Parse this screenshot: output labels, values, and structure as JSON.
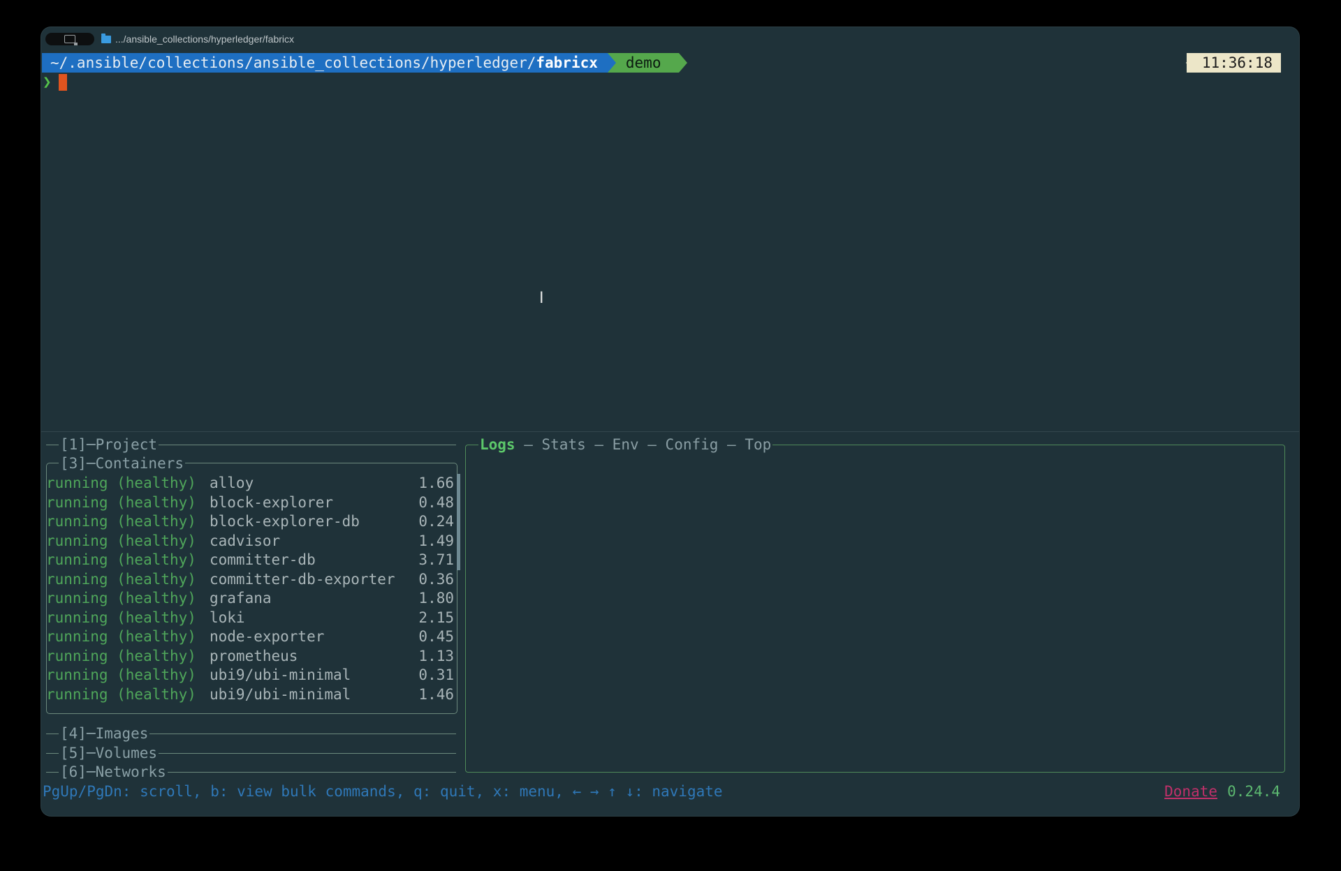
{
  "window": {
    "title": ".../ansible_collections/hyperledger/fabricx"
  },
  "prompt": {
    "path_prefix": "~/.ansible/collections/ansible_collections/hyperledger/",
    "path_current": "fabricx",
    "branch": "demo",
    "time": "11:36:18",
    "symbol": "❯"
  },
  "panels": {
    "project": "[1]─Project",
    "containers": "[3]─Containers",
    "images": "[4]─Images",
    "volumes": "[5]─Volumes",
    "networks": "[6]─Networks"
  },
  "containers": [
    {
      "status": "running (healthy)",
      "name": "alloy",
      "cpu": "1.66"
    },
    {
      "status": "running (healthy)",
      "name": "block-explorer",
      "cpu": "0.48"
    },
    {
      "status": "running (healthy)",
      "name": "block-explorer-db",
      "cpu": "0.24"
    },
    {
      "status": "running (healthy)",
      "name": "cadvisor",
      "cpu": "1.49"
    },
    {
      "status": "running (healthy)",
      "name": "committer-db",
      "cpu": "3.71"
    },
    {
      "status": "running (healthy)",
      "name": "committer-db-exporter",
      "cpu": "0.36"
    },
    {
      "status": "running (healthy)",
      "name": "grafana",
      "cpu": "1.80"
    },
    {
      "status": "running (healthy)",
      "name": "loki",
      "cpu": "2.15"
    },
    {
      "status": "running (healthy)",
      "name": "node-exporter",
      "cpu": "0.45"
    },
    {
      "status": "running (healthy)",
      "name": "prometheus",
      "cpu": "1.13"
    },
    {
      "status": "running (healthy)",
      "name": "ubi9/ubi-minimal",
      "cpu": "0.31"
    },
    {
      "status": "running (healthy)",
      "name": "ubi9/ubi-minimal",
      "cpu": "1.46"
    }
  ],
  "detail_tabs": {
    "logs": "Logs",
    "stats": "Stats",
    "env": "Env",
    "config": "Config",
    "top": "Top",
    "sep": " – "
  },
  "status_bar": {
    "help": "PgUp/PgDn: scroll, b: view bulk commands, q: quit, x: menu, ← → ↑ ↓: navigate",
    "donate": "Donate",
    "version": "0.24.4"
  },
  "colors": {
    "background": "#1f3239",
    "path_segment": "#1e6fc2",
    "branch_segment": "#55a84c",
    "status_green": "#4fa65a",
    "donate": "#c1306a"
  }
}
